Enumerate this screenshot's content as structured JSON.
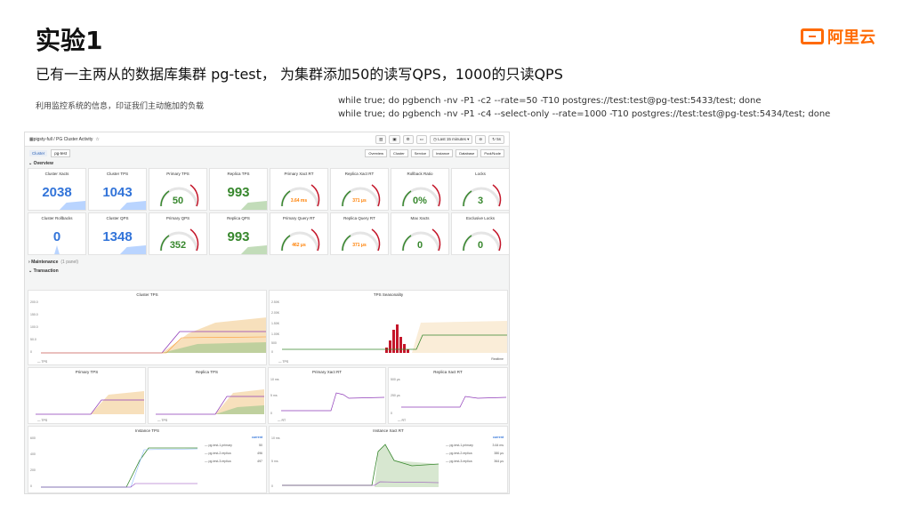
{
  "slide": {
    "title": "实验1",
    "brand": "阿里云",
    "subtitle": "已有一主两从的数据库集群 pg-test， 为集群添加50的读写QPS，1000的只读QPS",
    "note": "利用监控系统的信息，印证我们主动施加的负载",
    "commands": [
      "while true; do pgbench -nv -P1 -c2 --rate=50 -T10 postgres://test:test@pg-test:5433/test; done",
      "while true; do pgbench -nv -P1 -c4 --select-only --rate=1000 -T10 postgres://test:test@pg-test:5434/test; done"
    ]
  },
  "dashboard": {
    "breadcrumb": "pigsty-full / PG Cluster Activity",
    "time_range": "Last 15 minutes",
    "refresh": "5s",
    "var_label": "Cluster",
    "var_value": "pg-test",
    "links": [
      "Overview",
      "Cluster",
      "Service",
      "Instance",
      "Database",
      "Pool/Node"
    ],
    "rows": {
      "overview": "Overview",
      "maintenance": "Maintenance",
      "maintenance_sub": "(1 panel)",
      "transaction": "Transaction"
    },
    "stats": [
      {
        "title": "Cluster Xacts",
        "value": "2038",
        "type": "stat"
      },
      {
        "title": "Cluster TPS",
        "value": "1043",
        "type": "stat"
      },
      {
        "title": "Primary TPS",
        "value": "50",
        "type": "gauge",
        "level": 0.3
      },
      {
        "title": "Replica TPS",
        "value": "993",
        "type": "stat"
      },
      {
        "title": "Primary Xact RT",
        "value": "3.64 ms",
        "type": "gauge",
        "level": 0.25,
        "small": true
      },
      {
        "title": "Replica Xact RT",
        "value": "371 μs",
        "type": "gauge",
        "level": 0.1,
        "small": true
      },
      {
        "title": "Rollback Ratio",
        "value": "0%",
        "type": "gauge",
        "level": 0.0
      },
      {
        "title": "Locks",
        "value": "3",
        "type": "gauge",
        "level": 0.05
      },
      {
        "title": "Cluster Rollbacks",
        "value": "0",
        "type": "stat"
      },
      {
        "title": "Cluster QPS",
        "value": "1348",
        "type": "stat"
      },
      {
        "title": "Primary QPS",
        "value": "352",
        "type": "gauge",
        "level": 0.35
      },
      {
        "title": "Replica QPS",
        "value": "993",
        "type": "stat"
      },
      {
        "title": "Primary Query RT",
        "value": "462 μs",
        "type": "gauge",
        "level": 0.1,
        "small": true
      },
      {
        "title": "Replica Query RT",
        "value": "371 μs",
        "type": "gauge",
        "level": 0.1,
        "small": true
      },
      {
        "title": "Max Xacts",
        "value": "0",
        "type": "gauge",
        "level": 0.0
      },
      {
        "title": "Exclusive Locks",
        "value": "0",
        "type": "gauge",
        "level": 0.0
      }
    ],
    "panels": {
      "cluster_tps": {
        "title": "Cluster TPS",
        "legend": "TPS",
        "y_ticks": [
          "200.0",
          "150.0",
          "100.0",
          "50.0",
          "0"
        ],
        "x_ticks": [
          "15:44",
          "15:46",
          "15:48",
          "15:50",
          "15:52",
          "15:54",
          "15:56",
          "15:58"
        ]
      },
      "tps_seasonality": {
        "title": "TPS Seasonality",
        "legend_left": "TPS",
        "legend_right": "Realtime",
        "y_ticks": [
          "2.50K",
          "2.00K",
          "1.50K",
          "1.00K",
          "500",
          "0"
        ]
      },
      "primary_tps": {
        "title": "Primary TPS",
        "legend": "TPS"
      },
      "replica_tps": {
        "title": "Replica TPS",
        "legend": "TPS"
      },
      "primary_xact_rt": {
        "title": "Primary Xact RT",
        "legend": "RT",
        "y_ticks": [
          "10 ms",
          "5 ms",
          "0"
        ]
      },
      "replica_xact_rt": {
        "title": "Replica Xact RT",
        "legend": "RT",
        "y_ticks": [
          "500 μs",
          "250 μs",
          "0"
        ]
      },
      "instance_tps": {
        "title": "Instance TPS",
        "current_label": "current",
        "y_ticks": [
          "600",
          "400",
          "200",
          "0"
        ],
        "legend": [
          {
            "name": "pg-test-1.primary",
            "value": "50"
          },
          {
            "name": "pg-test-2.replica",
            "value": "496"
          },
          {
            "name": "pg-test-3.replica",
            "value": "497"
          }
        ]
      },
      "instance_xact_rt": {
        "title": "Instance Xact RT",
        "current_label": "current",
        "y_ticks": [
          "10 ms",
          "5 ms",
          "0"
        ],
        "legend": [
          {
            "name": "pg-test-1.primary",
            "value": "3.64 ms"
          },
          {
            "name": "pg-test-2.replica",
            "value": "380 μs"
          },
          {
            "name": "pg-test-3.replica",
            "value": "364 μs"
          }
        ]
      }
    },
    "colors": {
      "accent": "#ff6a00",
      "stat_blue": "#3274d9",
      "green": "#37872d",
      "red": "#c4162a",
      "purple": "#8f3bb8",
      "tan": "#f2cc8f"
    }
  }
}
